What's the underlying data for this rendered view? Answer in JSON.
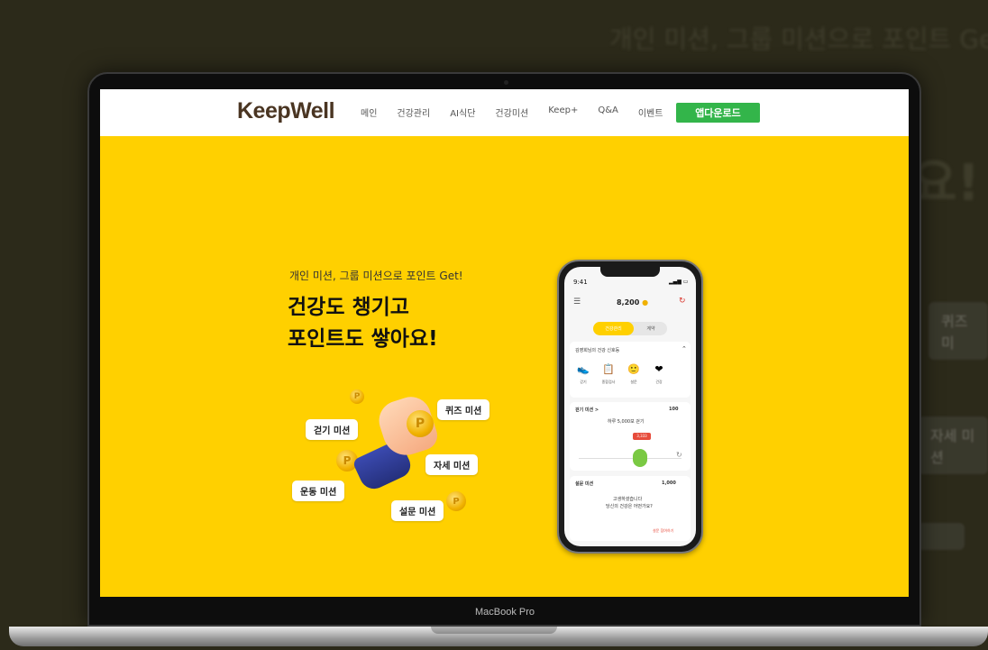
{
  "background": {
    "headline": "개인 미션, 그룹 미션으로 포인트 Ge",
    "big_text": "요!",
    "pill1": "퀴즈 미",
    "pill2": "자세 미션"
  },
  "laptop": {
    "chin_label": "MacBook Pro"
  },
  "site": {
    "logo": "KeepWell",
    "nav": [
      "메인",
      "건강관리",
      "AI식단",
      "건강미션",
      "Keep+",
      "Q&A",
      "이벤트"
    ],
    "download_button": "앱다운로드",
    "accent_color": "#ffd000",
    "button_color": "#33b54a"
  },
  "hero": {
    "subtitle": "개인 미션, 그룹 미션으로 포인트 Get!",
    "title_line1": "건강도 챙기고",
    "title_line2": "포인트도 쌓아요!",
    "missions": {
      "walk": "걷기 미션",
      "quiz": "퀴즈 미션",
      "posture": "자세 미션",
      "exercise": "운동 미션",
      "survey": "설문 미션"
    }
  },
  "phone": {
    "time": "9:41",
    "points": "8,200",
    "tab_active": "건강관리",
    "tab_inactive": "계약",
    "card1_title": "김영희님의 건강 신호등",
    "icons": [
      {
        "icon": "shoe-icon",
        "label": "걷기"
      },
      {
        "icon": "clipboard-icon",
        "label": "종합검사"
      },
      {
        "icon": "face-icon",
        "label": "설문"
      },
      {
        "icon": "heart-icon",
        "label": "건강"
      }
    ],
    "walk_mission_label": "걷기 미션 >",
    "walk_mission_points": "100",
    "walk_goal": "하루 5,000보 걷기",
    "walk_current": "3,333",
    "survey_mission_label": "설문 미션",
    "survey_mission_points": "1,000",
    "survey_text1": "고생하셨습니다",
    "survey_text2": "당신의 건강은 어떤가요?",
    "survey_button": "설문 참여하기"
  }
}
